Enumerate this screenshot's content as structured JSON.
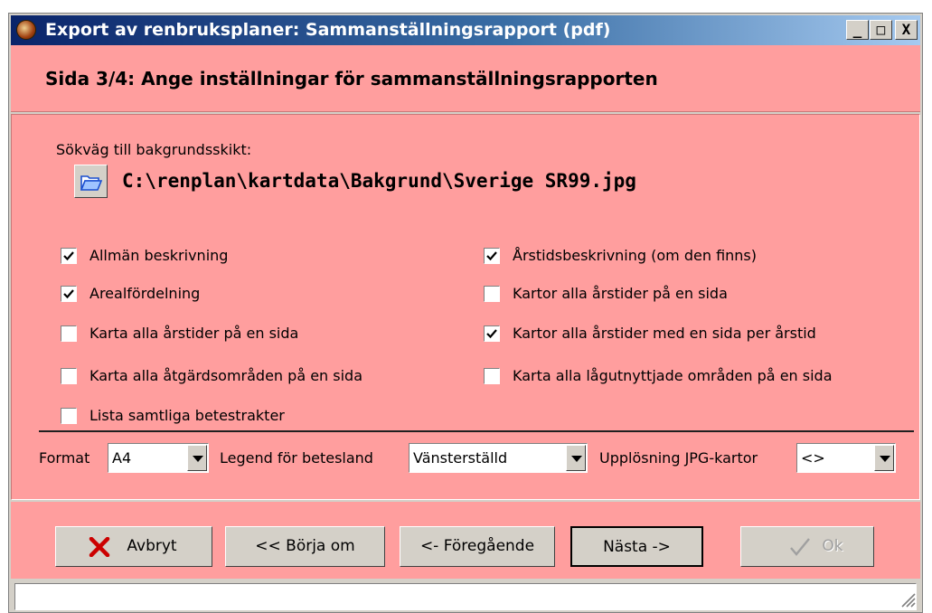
{
  "window": {
    "title": "Export av renbruksplaner: Sammanställningsrapport (pdf)",
    "controls": {
      "minimize": "_",
      "maximize": "□",
      "close": "X"
    }
  },
  "header": {
    "step_title": "Sida 3/4: Ange inställningar för sammanställningsrapporten"
  },
  "settings": {
    "background_path_label": "Sökväg till bakgrundsskikt:",
    "background_path": "C:\\renplan\\kartdata\\Bakgrund\\Sverige SR99.jpg",
    "checkboxes_left": [
      {
        "label": "Allmän beskrivning",
        "checked": true
      },
      {
        "label": "Arealfördelning",
        "checked": true
      },
      {
        "label": "Karta alla årstider på en sida",
        "checked": false
      },
      {
        "label": "Karta alla åtgärdsområden på en sida",
        "checked": false
      },
      {
        "label": "Lista samtliga betestrakter",
        "checked": false
      }
    ],
    "checkboxes_right": [
      {
        "label": "Årstidsbeskrivning (om den finns)",
        "checked": true
      },
      {
        "label": "Kartor alla årstider på en sida",
        "checked": false
      },
      {
        "label": "Kartor alla årstider med en sida per årstid",
        "checked": true
      },
      {
        "label": "Karta alla lågutnyttjade områden på en sida",
        "checked": false
      }
    ],
    "format": {
      "label": "Format",
      "value": "A4"
    },
    "legend": {
      "label": "Legend för betesland",
      "value": "Vänsterställd"
    },
    "resolution": {
      "label": "Upplösning JPG-kartor",
      "value": "<>"
    }
  },
  "buttons": {
    "cancel": "Avbryt",
    "restart": "<< Börja om",
    "previous": "<- Föregående",
    "next": "Nästa ->",
    "ok": "Ok"
  },
  "statusbar": {
    "text": ""
  },
  "colors": {
    "panel": "#ff9e9e",
    "title_start": "#0a246a",
    "title_end": "#a6caf0",
    "cancel_icon": "#cc0000"
  }
}
